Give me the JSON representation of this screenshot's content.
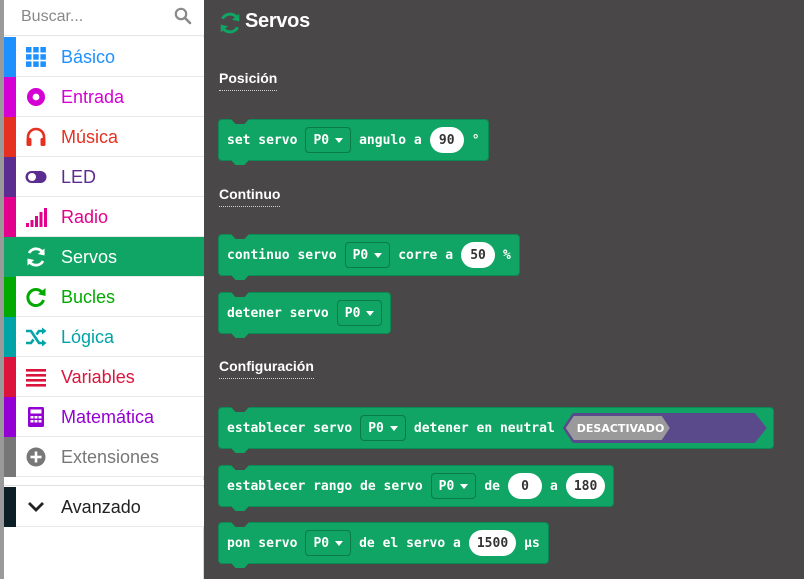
{
  "search": {
    "placeholder": "Buscar..."
  },
  "sidebar": {
    "items": [
      {
        "label": "Básico",
        "color": "#1e90ff",
        "icon": "grid-icon"
      },
      {
        "label": "Entrada",
        "color": "#d400d4",
        "icon": "circle-dot-icon"
      },
      {
        "label": "Música",
        "color": "#e63022",
        "icon": "headphones-icon"
      },
      {
        "label": "LED",
        "color": "#5c2d91",
        "icon": "toggle-icon"
      },
      {
        "label": "Radio",
        "color": "#e3008c",
        "icon": "signal-bars-icon"
      },
      {
        "label": "Servos",
        "color": "#10a564",
        "icon": "refresh-icon",
        "selected": true
      },
      {
        "label": "Bucles",
        "color": "#00aa00",
        "icon": "loop-icon"
      },
      {
        "label": "Lógica",
        "color": "#00a4a6",
        "icon": "shuffle-icon"
      },
      {
        "label": "Variables",
        "color": "#dc143c",
        "icon": "list-lines-icon"
      },
      {
        "label": "Matemática",
        "color": "#9400d3",
        "icon": "calculator-icon"
      },
      {
        "label": "Extensiones",
        "color": "#777777",
        "icon": "plus-circle-icon"
      }
    ],
    "advanced": {
      "label": "Avanzado",
      "color": "#000000",
      "icon": "chevron-down-icon"
    }
  },
  "flyout": {
    "title": "Servos",
    "sections": {
      "posicion": "Posición",
      "continuo": "Continuo",
      "configuracion": "Configuración"
    },
    "blocks": {
      "set_servo": {
        "t1": "set servo",
        "pin": "P0",
        "t2": "angulo a",
        "value": "90",
        "suffix": "°"
      },
      "continuo_servo": {
        "t1": "continuo servo",
        "pin": "P0",
        "t2": "corre a",
        "value": "50",
        "suffix": "%"
      },
      "detener_servo": {
        "t1": "detener servo",
        "pin": "P0"
      },
      "establecer_neutral": {
        "t1": "establecer servo",
        "pin": "P0",
        "t2": "detener en neutral",
        "toggle": "DESACTIVADO"
      },
      "establecer_rango": {
        "t1": "establecer rango de servo",
        "pin": "P0",
        "t2": "de",
        "v1": "0",
        "t3": "a",
        "v2": "180"
      },
      "pon_servo": {
        "t1": "pon servo",
        "pin": "P0",
        "t2": "de el servo a",
        "value": "1500",
        "suffix": "µs"
      }
    }
  },
  "colors": {
    "servos_green": "#10a564",
    "flyout_bg": "#4a4748",
    "toggle_purple": "#5b4a8b"
  }
}
